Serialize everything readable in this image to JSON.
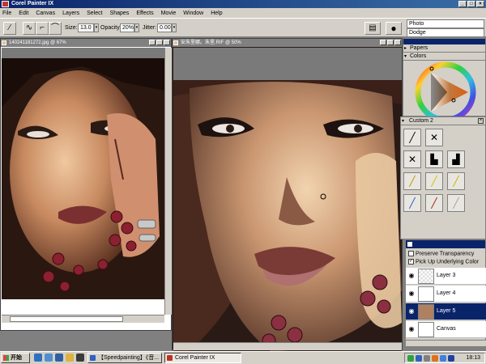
{
  "window": {
    "title": "Corel Painter IX"
  },
  "menu": [
    "File",
    "Edit",
    "Canvas",
    "Layers",
    "Select",
    "Shapes",
    "Effects",
    "Movie",
    "Window",
    "Help"
  ],
  "property_bar": {
    "size_label": "Size:",
    "size_value": "13.0",
    "opacity_label": "Opacity:",
    "opacity_value": "20%",
    "jitter_label": "Jitter:",
    "jitter_value": "0.00",
    "brush_category": "Photo",
    "brush_variant": "Dodge"
  },
  "documents": {
    "reference": {
      "title": "140241181272.jpg @ 67%"
    },
    "canvas": {
      "title": "安朱里娜。朱里.RIF @ 50%"
    }
  },
  "panels": {
    "papers": "Papers",
    "colors": "Colors",
    "variants": "Custom 2",
    "variant_icons": [
      "pencil-icon",
      "eraser-icon",
      "airbrush-icon",
      "stamp-icon",
      "stamp-icon",
      "pen-icon",
      "marker-icon",
      "marker-icon",
      "pencil-icon",
      "brush-icon",
      "brush-icon",
      "pencil-icon"
    ]
  },
  "layers": {
    "preserve_transparency": "Preserve Transparency",
    "pick_up_underlying_color": "Pick Up Underlying Color",
    "items": [
      {
        "name": "Layer 3",
        "selected": false
      },
      {
        "name": "Layer 4",
        "selected": false
      },
      {
        "name": "Layer 5",
        "selected": true
      },
      {
        "name": "Canvas",
        "selected": false
      }
    ]
  },
  "taskbar": {
    "start": "开始",
    "tasks": [
      "【Speedpainting】《音...",
      "Corel Painter IX"
    ],
    "clock": "18:13"
  }
}
